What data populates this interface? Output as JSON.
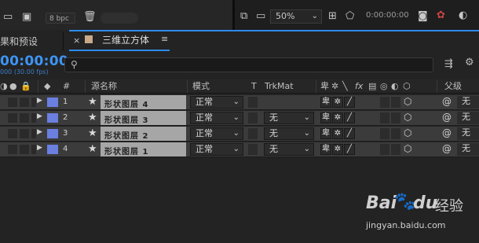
{
  "top": {
    "bpc": "8 bpc",
    "zoom": "50%",
    "timecode": "0:00:00:00"
  },
  "tabs": {
    "left_panel": "果和预设",
    "active": "三维立方体"
  },
  "time": {
    "timecode": "00:00:00",
    "fps": "000 (30.00 fps)"
  },
  "columns": {
    "hash": "#",
    "source_name": "源名称",
    "mode": "模式",
    "t": "T",
    "trkmat": "TrkMat",
    "parent": "父级"
  },
  "layers": [
    {
      "num": "1",
      "name": "形状图层 4",
      "mode": "正常",
      "trkmat": "",
      "parent": "无",
      "label_color": "#6b7fe0"
    },
    {
      "num": "2",
      "name": "形状图层 3",
      "mode": "正常",
      "trkmat": "无",
      "parent": "无",
      "label_color": "#6b7fe0"
    },
    {
      "num": "3",
      "name": "形状图层 2",
      "mode": "正常",
      "trkmat": "无",
      "parent": "无",
      "label_color": "#6b7fe0"
    },
    {
      "num": "4",
      "name": "形状图层 1",
      "mode": "正常",
      "trkmat": "无",
      "parent": "无",
      "label_color": "#6b7fe0"
    }
  ],
  "watermark": {
    "brand": "Bai",
    "brand2": "du",
    "suffix": "经验",
    "url": "jingyan.baidu.com"
  },
  "colors": {
    "accent": "#2d8ceb",
    "timecode": "#3d95f5",
    "label": "#6b7fe0"
  }
}
